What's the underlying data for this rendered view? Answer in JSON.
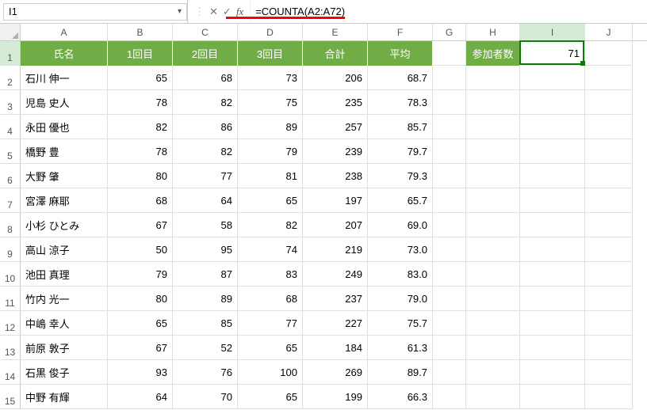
{
  "formula_bar": {
    "name_box": "I1",
    "formula": "=COUNTA(A2:A72)"
  },
  "col_letters": [
    "A",
    "B",
    "C",
    "D",
    "E",
    "F",
    "G",
    "H",
    "I",
    "J"
  ],
  "headers": {
    "A": "氏名",
    "B": "1回目",
    "C": "2回目",
    "D": "3回目",
    "E": "合計",
    "F": "平均",
    "H": "参加者数"
  },
  "i1_value": "71",
  "rows": [
    {
      "n": "2",
      "name": "石川 伸一",
      "a": "65",
      "b": "68",
      "c": "73",
      "sum": "206",
      "avg": "68.7"
    },
    {
      "n": "3",
      "name": "児島 史人",
      "a": "78",
      "b": "82",
      "c": "75",
      "sum": "235",
      "avg": "78.3"
    },
    {
      "n": "4",
      "name": "永田 優也",
      "a": "82",
      "b": "86",
      "c": "89",
      "sum": "257",
      "avg": "85.7"
    },
    {
      "n": "5",
      "name": "橋野 豊",
      "a": "78",
      "b": "82",
      "c": "79",
      "sum": "239",
      "avg": "79.7"
    },
    {
      "n": "6",
      "name": "大野 肇",
      "a": "80",
      "b": "77",
      "c": "81",
      "sum": "238",
      "avg": "79.3"
    },
    {
      "n": "7",
      "name": "宮澤 麻耶",
      "a": "68",
      "b": "64",
      "c": "65",
      "sum": "197",
      "avg": "65.7"
    },
    {
      "n": "8",
      "name": "小杉 ひとみ",
      "a": "67",
      "b": "58",
      "c": "82",
      "sum": "207",
      "avg": "69.0"
    },
    {
      "n": "9",
      "name": "高山 涼子",
      "a": "50",
      "b": "95",
      "c": "74",
      "sum": "219",
      "avg": "73.0"
    },
    {
      "n": "10",
      "name": "池田 真理",
      "a": "79",
      "b": "87",
      "c": "83",
      "sum": "249",
      "avg": "83.0"
    },
    {
      "n": "11",
      "name": "竹内 光一",
      "a": "80",
      "b": "89",
      "c": "68",
      "sum": "237",
      "avg": "79.0"
    },
    {
      "n": "12",
      "name": "中嶋 幸人",
      "a": "65",
      "b": "85",
      "c": "77",
      "sum": "227",
      "avg": "75.7"
    },
    {
      "n": "13",
      "name": "前原 敦子",
      "a": "67",
      "b": "52",
      "c": "65",
      "sum": "184",
      "avg": "61.3"
    },
    {
      "n": "14",
      "name": "石黒 俊子",
      "a": "93",
      "b": "76",
      "c": "100",
      "sum": "269",
      "avg": "89.7"
    },
    {
      "n": "15",
      "name": "中野 有輝",
      "a": "64",
      "b": "70",
      "c": "65",
      "sum": "199",
      "avg": "66.3"
    }
  ]
}
